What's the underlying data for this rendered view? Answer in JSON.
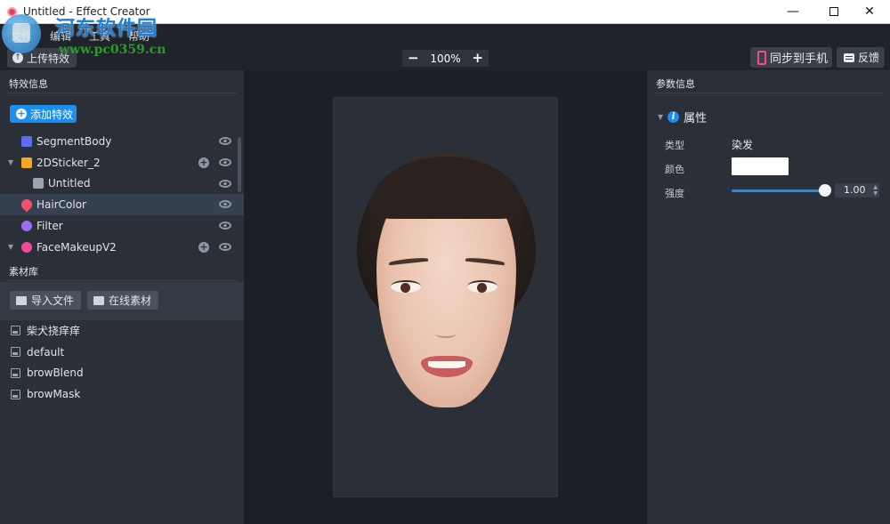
{
  "window": {
    "title": "Untitled - Effect Creator",
    "minimize": "—",
    "close": "✕"
  },
  "watermark": {
    "name": "河东软件园",
    "url": "www.pc0359.cn"
  },
  "menu": {
    "items": [
      "文件",
      "编辑",
      "工具",
      "帮助"
    ]
  },
  "toolbar": {
    "upload_label": "上传特效",
    "zoom_minus": "−",
    "zoom_value": "100%",
    "zoom_plus": "+",
    "sync_label": "同步到手机",
    "feedback_label": "反馈"
  },
  "effects_panel": {
    "header": "特效信息",
    "add_label": "添加特效",
    "items": [
      {
        "label": "SegmentBody",
        "icon": "segment-body-icon",
        "color": "#5b6cf5"
      },
      {
        "label": "2DSticker_2",
        "icon": "sticker-icon",
        "color": "#f5a623"
      },
      {
        "label": "Untitled",
        "icon": "puzzle-icon",
        "color": "#9aa3ae"
      },
      {
        "label": "HairColor",
        "icon": "drop-icon",
        "color": "#f0516e"
      },
      {
        "label": "Filter",
        "icon": "filter-icon",
        "color": "#9b6cf0"
      },
      {
        "label": "FaceMakeupV2",
        "icon": "makeup-icon",
        "color": "#f04a9c"
      }
    ]
  },
  "materials_panel": {
    "header": "素材库",
    "import_label": "导入文件",
    "online_label": "在线素材",
    "items": [
      "柴犬挠痒痒",
      "default",
      "browBlend",
      "browMask"
    ]
  },
  "properties_panel": {
    "header": "参数信息",
    "section_title": "属性",
    "type_label": "类型",
    "type_value": "染发",
    "color_label": "颜色",
    "color_value": "#ffffff",
    "strength_label": "强度",
    "strength_value": "1.00"
  }
}
